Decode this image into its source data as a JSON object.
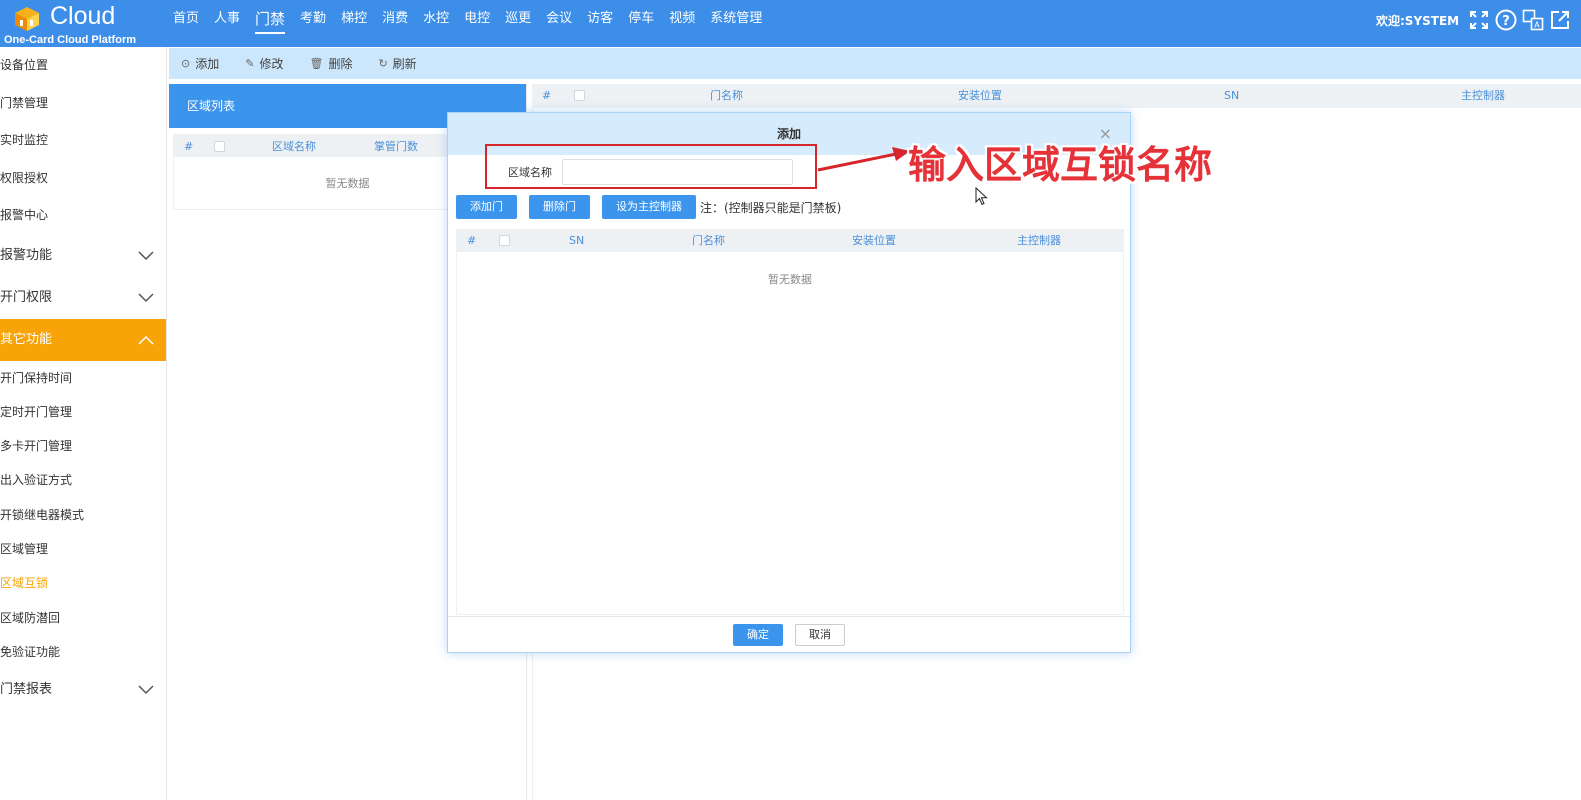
{
  "header": {
    "logo_text": "Cloud",
    "logo_sub": "One-Card Cloud Platform",
    "nav": [
      "首页",
      "人事",
      "门禁",
      "考勤",
      "梯控",
      "消费",
      "水控",
      "电控",
      "巡更",
      "会议",
      "访客",
      "停车",
      "视频",
      "系统管理"
    ],
    "active_nav_index": 2,
    "welcome": "欢迎:SYSTEM",
    "icons": [
      "fullscreen-icon",
      "help-icon",
      "language-icon",
      "logout-icon"
    ]
  },
  "sidebar": {
    "items": [
      {
        "label": "设备位置",
        "type": "item"
      },
      {
        "label": "门禁管理",
        "type": "item"
      },
      {
        "label": "实时监控",
        "type": "item"
      },
      {
        "label": "权限授权",
        "type": "item"
      },
      {
        "label": "报警中心",
        "type": "item"
      },
      {
        "label": "报警功能",
        "type": "group"
      },
      {
        "label": "开门权限",
        "type": "group"
      },
      {
        "label": "其它功能",
        "type": "group-open"
      },
      {
        "label": "开门保持时间",
        "type": "sub"
      },
      {
        "label": "定时开门管理",
        "type": "sub"
      },
      {
        "label": "多卡开门管理",
        "type": "sub"
      },
      {
        "label": "出入验证方式",
        "type": "sub"
      },
      {
        "label": "开锁继电器模式",
        "type": "sub"
      },
      {
        "label": "区域管理",
        "type": "sub"
      },
      {
        "label": "区域互锁",
        "type": "sub-current"
      },
      {
        "label": "区域防潜回",
        "type": "sub"
      },
      {
        "label": "免验证功能",
        "type": "sub"
      },
      {
        "label": "门禁报表",
        "type": "group"
      }
    ]
  },
  "toolbar": {
    "add": "添加",
    "edit": "修改",
    "delete": "删除",
    "refresh": "刷新"
  },
  "left_panel": {
    "title": "区域列表",
    "col_index": "#",
    "col_name": "区域名称",
    "col_doors": "掌管门数",
    "empty": "暂无数据"
  },
  "right_table": {
    "col_index": "#",
    "col_door_name": "门名称",
    "col_location": "安装位置",
    "col_sn": "SN",
    "col_controller": "主控制器"
  },
  "modal": {
    "title": "添加",
    "close": "×",
    "field_label": "区域名称",
    "field_value": "",
    "btn_add_door": "添加门",
    "btn_delete_door": "删除门",
    "btn_set_master": "设为主控制器",
    "note": "注：(控制器只能是门禁板)",
    "table": {
      "col_index": "#",
      "col_sn": "SN",
      "col_door_name": "门名称",
      "col_location": "安装位置",
      "col_controller": "主控制器",
      "empty": "暂无数据"
    },
    "ok": "确定",
    "cancel": "取消"
  },
  "annotation": {
    "text": "输入区域互锁名称",
    "color": "#e53238"
  },
  "colors": {
    "header_bg": "#3c8ee8",
    "accent_orange": "#f8a307",
    "button_blue": "#3c95ed",
    "toolbar_bg": "#cce6fb"
  }
}
